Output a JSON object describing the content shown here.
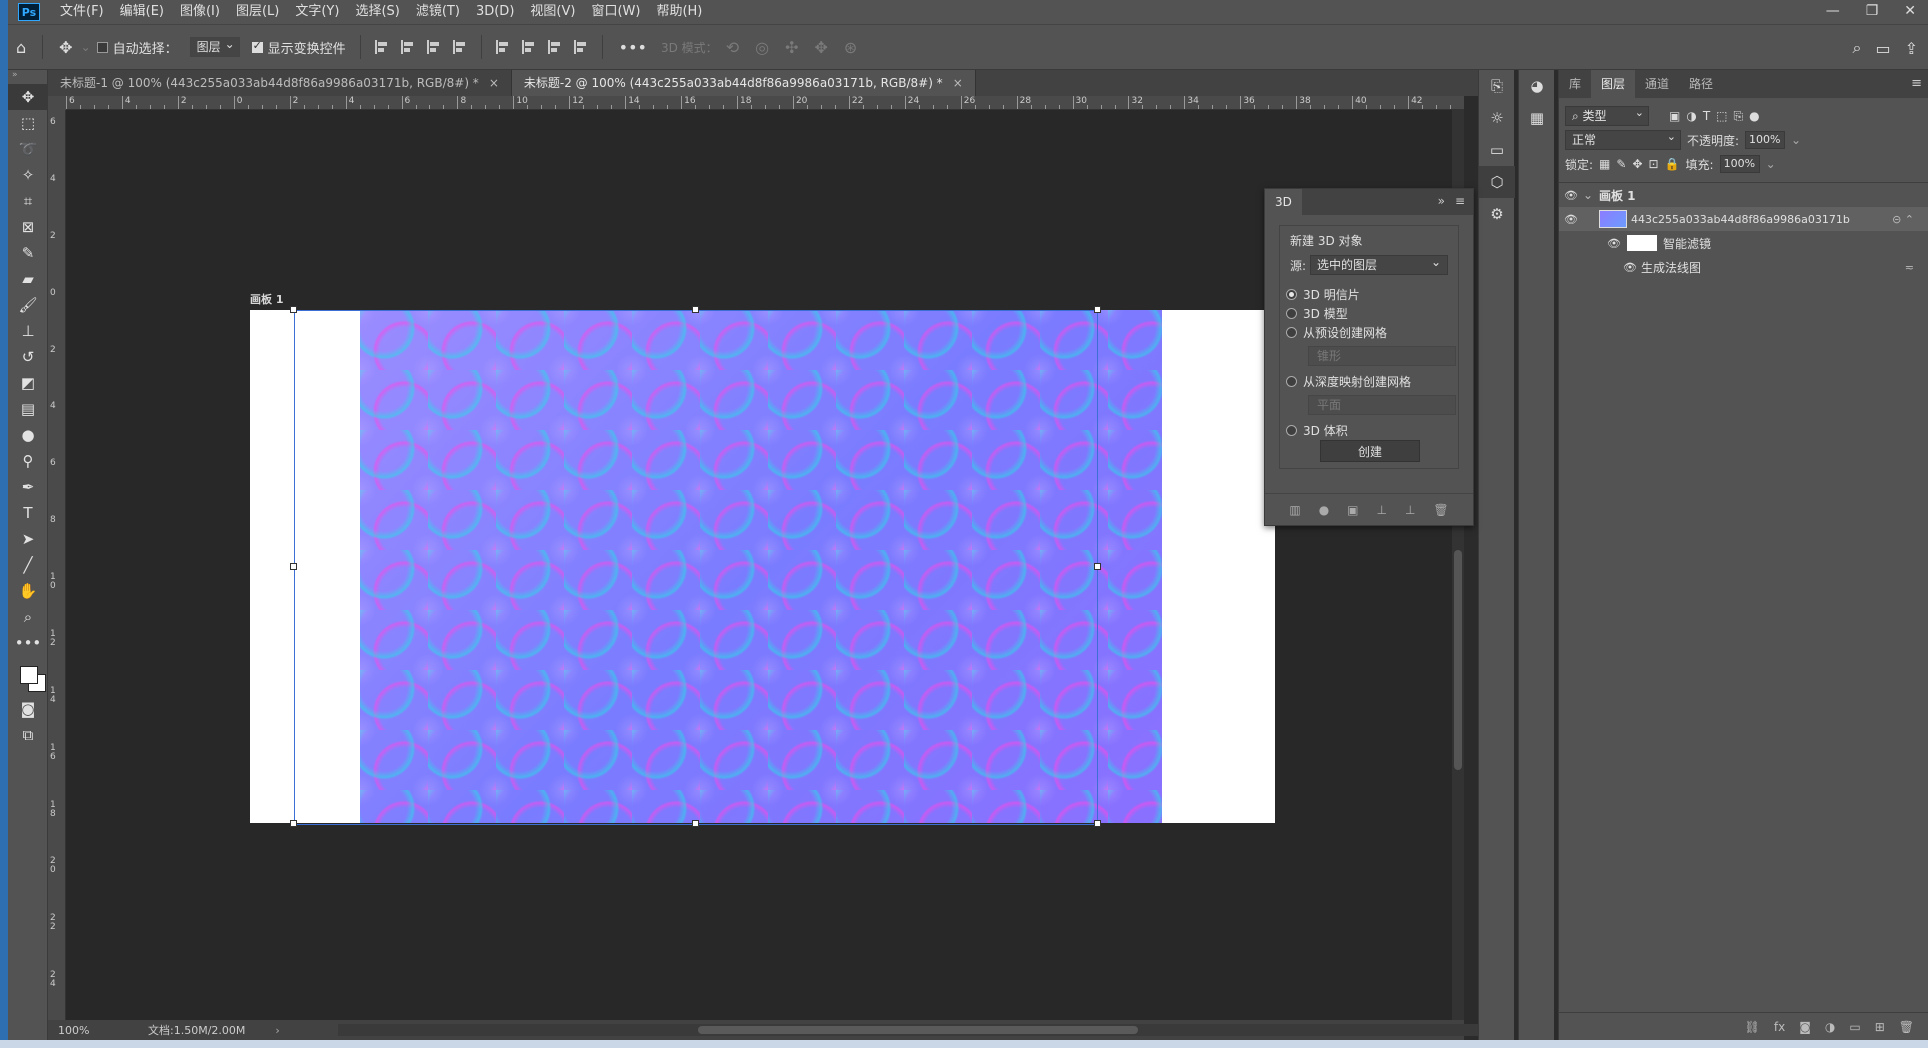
{
  "app": {
    "logo": "Ps",
    "menu": [
      "文件(F)",
      "编辑(E)",
      "图像(I)",
      "图层(L)",
      "文字(Y)",
      "选择(S)",
      "滤镜(T)",
      "3D(D)",
      "视图(V)",
      "窗口(W)",
      "帮助(H)"
    ],
    "window_controls": [
      "—",
      "❐",
      "✕"
    ]
  },
  "options": {
    "auto_select_label": "自动选择：",
    "auto_select_checked": false,
    "auto_select_target": "图层",
    "show_transform_label": "显示变换控件",
    "show_transform_checked": true,
    "more": "•••",
    "mode_3d_label": "3D 模式："
  },
  "tabs": [
    {
      "label": "未标题-1 @ 100% (443c255a033ab44d8f86a9986a03171b, RGB/8#) *",
      "active": false
    },
    {
      "label": "未标题-2 @ 100% (443c255a033ab44d8f86a9986a03171b, RGB/8#) *",
      "active": true
    }
  ],
  "ruler_h": [
    "6",
    "4",
    "2",
    "0",
    "2",
    "4",
    "6",
    "8",
    "10",
    "12",
    "14",
    "16",
    "18",
    "20",
    "22",
    "24",
    "26",
    "28",
    "30",
    "32",
    "34",
    "36",
    "38",
    "40",
    "42"
  ],
  "ruler_v": [
    "6",
    "4",
    "2",
    "0",
    "2",
    "4",
    "6",
    "8",
    "1 0",
    "1 2",
    "1 4",
    "1 6",
    "1 8",
    "2 0",
    "2 2",
    "2 4"
  ],
  "artboard": {
    "label": "画板 1"
  },
  "status": {
    "zoom": "100%",
    "doc": "文档:1.50M/2.00M"
  },
  "panel_3d": {
    "tab": "3D",
    "title": "新建 3D 对象",
    "source_label": "源:",
    "source_value": "选中的图层",
    "options": [
      {
        "label": "3D 明信片",
        "checked": true
      },
      {
        "label": "3D 模型",
        "checked": false
      },
      {
        "label": "从预设创建网格",
        "checked": false,
        "sub": "锥形"
      },
      {
        "label": "从深度映射创建网格",
        "checked": false,
        "sub": "平面"
      },
      {
        "label": "3D 体积",
        "checked": false
      }
    ],
    "create_label": "创建"
  },
  "layers_panel": {
    "tabs": [
      "库",
      "图层",
      "通道",
      "路径"
    ],
    "active_tab": "图层",
    "filter_label": "类型",
    "blend_mode": "正常",
    "opacity_label": "不透明度:",
    "opacity_value": "100%",
    "lock_label": "锁定:",
    "fill_label": "填充:",
    "fill_value": "100%",
    "layers": [
      {
        "name": "画板 1",
        "type": "artboard"
      },
      {
        "name": "443c255a033ab44d8f86a9986a03171b",
        "type": "smart-object",
        "selected": true
      },
      {
        "name": "智能滤镜",
        "type": "smart-filter"
      },
      {
        "name": "生成法线图",
        "type": "filter"
      }
    ]
  },
  "colors": {
    "ui_bg": "#535353",
    "canvas_bg": "#282828",
    "selection": "#3b6fd6",
    "taskbar_blue": "#2d6fb0"
  }
}
